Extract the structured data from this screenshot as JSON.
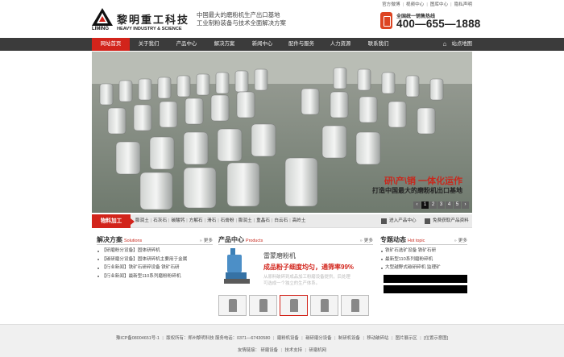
{
  "header": {
    "logo_cn": "黎明重工科技",
    "logo_en_brand": "LIMING",
    "logo_en_sub": "HEAVY INDUSTRY & SCIENCE",
    "slogan_line1": "中国最大的磨粉机生产出口基地",
    "slogan_line2": "工业制粉装备与技术全面解决方案",
    "top_links": [
      "官方微博",
      "视频中心",
      "图库中心",
      "隐私声明"
    ],
    "hotline_label": "全国统一销售热线",
    "hotline_number": "400—655—1888"
  },
  "nav": {
    "items": [
      "网站首页",
      "关于我们",
      "产品中心",
      "解决方案",
      "新闻中心",
      "配件与服务",
      "人力资源",
      "联系我们"
    ],
    "site_map": "站点地图"
  },
  "banner": {
    "headline": "研\\产\\销 一体化运作",
    "subline": "打造中国最大的磨粉机出口基地",
    "pages": [
      "1",
      "2",
      "3",
      "4",
      "5"
    ],
    "active_page": "1"
  },
  "strip": {
    "title": "物料加工",
    "links": [
      "膨润土",
      "石灰石",
      "碳酸钙",
      "方解石",
      "滑石",
      "石膏粉",
      "膨润土",
      "重晶石",
      "白云石",
      "高岭土"
    ],
    "btn_entry": "进入产品中心",
    "btn_download": "免费获取产品资料"
  },
  "solutions": {
    "title": "解决方案",
    "title_en": "Solutions",
    "more": "更多",
    "items": [
      "【研磨粉分设备】固体研碎机",
      "【碳研磨分设备】固体研碎机主要用于金属",
      "【行业新闻】铁矿石研碎设备 铁矿石研",
      "【行业新闻】最新型110系列磨粉粉碎机"
    ]
  },
  "products": {
    "title": "产品中心",
    "title_en": "Products",
    "more": "更多",
    "name": "雷蒙磨粉机",
    "desc": "成品粉子细度均匀，通筛率99%",
    "detail1": "从原料破碎到成品加工粉磨设备提供，后处理",
    "detail2": "可选成一个独立的生产体系。"
  },
  "news": {
    "title": "专题动态",
    "title_en": "Hot topic",
    "more": "更多",
    "items": [
      "铁矿石选矿设备 铁矿石研",
      "最新型110系列磨粉碎机",
      "大型越野式碳研碎机 监理矿"
    ]
  },
  "footer": {
    "line1": [
      "豫ICP备08004651号-1",
      "版权所有：郑州黎明科技  服务电话：0371—67430580",
      "磨粉机设备",
      "碳研磨分设备",
      "制研机设备",
      "移动破碎站",
      "图片展示区",
      "[位置示意图]"
    ],
    "line2": [
      "友情链接：",
      "研磨设备",
      "技术支持",
      "研磨机网"
    ]
  }
}
